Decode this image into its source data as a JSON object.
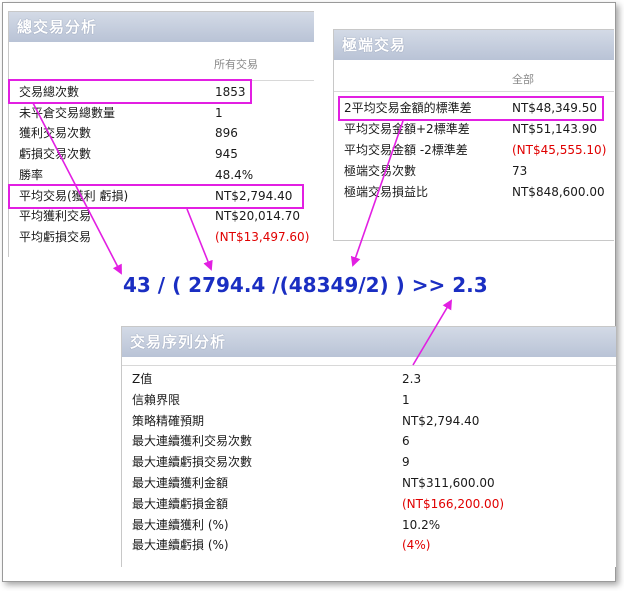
{
  "overall": {
    "title": "總交易分析",
    "column": "所有交易",
    "rows": [
      {
        "label": "交易總次數",
        "value": "1853",
        "neg": false
      },
      {
        "label": "未平倉交易總數量",
        "value": "1",
        "neg": false
      },
      {
        "label": "獲利交易次數",
        "value": "896",
        "neg": false
      },
      {
        "label": "虧損交易次數",
        "value": "945",
        "neg": false
      },
      {
        "label": "勝率",
        "value": "48.4%",
        "neg": false
      },
      {
        "label": "平均交易(獲利 虧損)",
        "value": "NT$2,794.40",
        "neg": false
      },
      {
        "label": "平均獲利交易",
        "value": "NT$20,014.70",
        "neg": false
      },
      {
        "label": "平均虧損交易",
        "value": "(NT$13,497.60)",
        "neg": true
      }
    ]
  },
  "extreme": {
    "title": "極端交易",
    "column": "全部",
    "rows": [
      {
        "label": "2平均交易金額的標準差",
        "value": "NT$48,349.50",
        "neg": false
      },
      {
        "label": "平均交易金額+2標準差",
        "value": "NT$51,143.90",
        "neg": false
      },
      {
        "label": "平均交易金額 -2標準差",
        "value": "(NT$45,555.10)",
        "neg": true
      },
      {
        "label": "極端交易次數",
        "value": "73",
        "neg": false
      },
      {
        "label": "極端交易損益比",
        "value": "NT$848,600.00",
        "neg": false
      }
    ]
  },
  "formula": "43 / ( 2794.4 /(48349/2) ) >> 2.3",
  "sequence": {
    "title": "交易序列分析",
    "rows": [
      {
        "label": "Z值",
        "value": "2.3",
        "neg": false
      },
      {
        "label": "信賴界限",
        "value": "1",
        "neg": false
      },
      {
        "label": "策略精確預期",
        "value": "NT$2,794.40",
        "neg": false
      },
      {
        "label": "最大連續獲利交易次數",
        "value": "6",
        "neg": false
      },
      {
        "label": "最大連續虧損交易次數",
        "value": "9",
        "neg": false
      },
      {
        "label": "最大連續獲利金額",
        "value": "NT$311,600.00",
        "neg": false
      },
      {
        "label": "最大連續虧損金額",
        "value": "(NT$166,200.00)",
        "neg": true
      },
      {
        "label": "最大連續獲利 (%)",
        "value": "10.2%",
        "neg": false
      },
      {
        "label": "最大連續虧損 (%)",
        "value": "(4%)",
        "neg": true
      }
    ]
  },
  "colors": {
    "highlight": "#e21fe2",
    "formula": "#1a2ec2",
    "negative": "#e00000"
  }
}
